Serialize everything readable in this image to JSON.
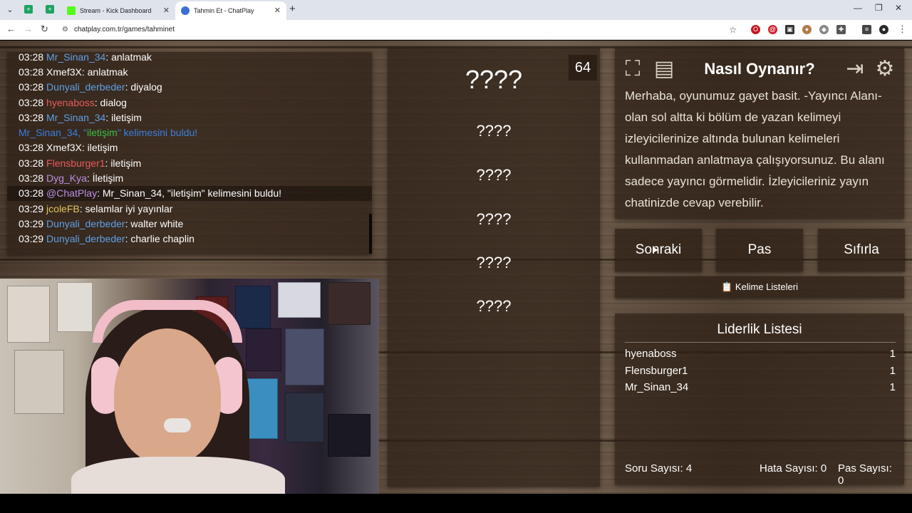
{
  "browser": {
    "tabs": [
      {
        "title": "Stream - Kick Dashboard",
        "active": false
      },
      {
        "title": "Tahmin Et - ChatPlay",
        "active": true
      }
    ],
    "url": "chatplay.com.tr/games/tahminet"
  },
  "chat": {
    "lines": [
      {
        "time": "03:28",
        "nick": "Mr_Sinan_34",
        "msg": ": anlatmak"
      },
      {
        "time": "03:28",
        "nick": "Xmef3X",
        "msg": ": anlatmak"
      },
      {
        "time": "03:28",
        "nick": "Dunyali_derbeder",
        "msg": ": diyalog"
      },
      {
        "time": "03:28",
        "nick": "hyenaboss",
        "msg": ": dialog"
      },
      {
        "time": "03:28",
        "nick": "Mr_Sinan_34",
        "msg": ": iletişim"
      },
      {
        "found_pre": "Mr_Sinan_34, \"",
        "found_word": "iletişim",
        "found_post": "\" kelimesini buldu!"
      },
      {
        "time": "03:28",
        "nick": "Xmef3X",
        "msg": ": iletişim"
      },
      {
        "time": "03:28",
        "nick": "Flensburger1",
        "msg": ": iletişim"
      },
      {
        "time": "03:28",
        "nick": "Dyg_Kya",
        "msg": ": İletişim"
      },
      {
        "time": "03:28",
        "nick": "@ChatPlay",
        "msg": ": Mr_Sinan_34, \"iletişim\" kelimesini buldu!"
      },
      {
        "time": "03:29",
        "nick": "jcoleFB",
        "msg": ": selamlar iyi yayınlar"
      },
      {
        "time": "03:29",
        "nick": "Dunyali_derbeder",
        "msg": ": walter white"
      },
      {
        "time": "03:29",
        "nick": "Dunyali_derbeder",
        "msg": ": charlie chaplin"
      }
    ]
  },
  "game": {
    "counter": "64",
    "main_word": "????",
    "forbidden_words": [
      "????",
      "????",
      "????",
      "????",
      "????"
    ]
  },
  "howto": {
    "title": "Nasıl Oynanır?",
    "text": "Merhaba, oyunumuz gayet basit. -Yayıncı Alanı- olan sol altta ki bölüm de yazan kelimeyi izleyicilerinize altında bulunan kelimeleri kullanmadan anlatmaya çalışıyorsunuz. Bu alanı sadece yayıncı görmelidir. İzleyicileriniz yayın chatinizde cevap verebilir."
  },
  "buttons": {
    "next": "Sonraki",
    "pass": "Pas",
    "reset": "Sıfırla",
    "word_lists": "📋 Kelime Listeleri"
  },
  "leaderboard": {
    "title": "Liderlik Listesi",
    "rows": [
      {
        "name": "hyenaboss",
        "score": "1"
      },
      {
        "name": "Flensburger1",
        "score": "1"
      },
      {
        "name": "Mr_Sinan_34",
        "score": "1"
      }
    ],
    "stats": {
      "questions": "Soru Sayısı: 4",
      "errors": "Hata Sayısı: 0",
      "passes": "Pas Sayısı: 0"
    }
  }
}
